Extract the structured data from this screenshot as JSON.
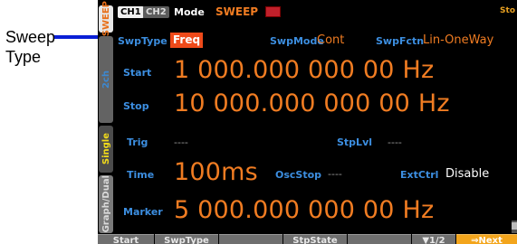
{
  "annotation": {
    "line1": "Sweep",
    "line2": "Type"
  },
  "side_tabs": [
    "SWEEP",
    "2ch",
    "Single",
    "Graph/Dual"
  ],
  "top": {
    "ch1": "CH1",
    "ch2": "CH2",
    "mode_label": "Mode",
    "mode_value": "SWEEP",
    "status": "Sto"
  },
  "params": {
    "swp_type_label": "SwpType",
    "swp_type_value": "Freq",
    "swp_mode_label": "SwpMode",
    "swp_mode_value": "Cont",
    "swp_fctn_label": "SwpFctn",
    "swp_fctn_value": "Lin-OneWay",
    "start_label": "Start",
    "start_value": "1 000.000 000 00 Hz",
    "stop_label": "Stop",
    "stop_value": "10 000.000 000 00 Hz",
    "trig_label": "Trig",
    "trig_value": "----",
    "stplvl_label": "StpLvl",
    "stplvl_value": "----",
    "time_label": "Time",
    "time_value": "100ms",
    "oscstop_label": "OscStop",
    "oscstop_value": "----",
    "extctrl_label": "ExtCtrl",
    "extctrl_value": "Disable",
    "marker_label": "Marker",
    "marker_value": "5 000.000 000 00 Hz"
  },
  "softkeys": [
    "Start",
    "SwpType",
    "",
    "StpState",
    "",
    "▼1/2",
    "⇒Next"
  ],
  "colors": {
    "label_blue": "#3c8ee0",
    "value_orange": "#f07c22",
    "highlight": "#ef4a1a",
    "next_key": "#f3a51c"
  }
}
